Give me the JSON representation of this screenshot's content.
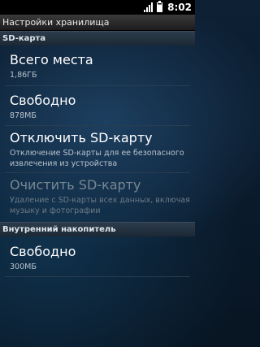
{
  "status_bar": {
    "time": "8:02",
    "icons": [
      "signal-icon",
      "battery-icon"
    ]
  },
  "title_bar": {
    "title": "Настройки хранилища"
  },
  "sections": [
    {
      "header": "SD-карта",
      "items": [
        {
          "title": "Всего места",
          "value": "1,86ГБ"
        },
        {
          "title": "Свободно",
          "value": "878МБ"
        },
        {
          "title": "Отключить SD-карту",
          "description": "Отключение SD-карты для ее безопасного извлечения из устройства"
        },
        {
          "title": "Очистить SD-карту",
          "description": "Удаление с SD-карты всех данных, включая музыку и фотографии",
          "disabled": true
        }
      ]
    },
    {
      "header": "Внутренний накопитель",
      "items": [
        {
          "title": "Свободно",
          "value": "300МБ"
        }
      ]
    }
  ]
}
